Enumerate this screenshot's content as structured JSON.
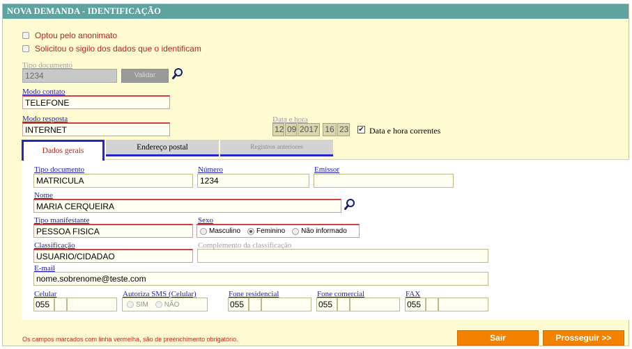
{
  "title": "NOVA DEMANDA - IDENTIFICAÇÃO",
  "options": {
    "anonimato": "Optou pelo anonimato",
    "sigilo": "Solicitou o sigilo dos dados que o identificam"
  },
  "tipo_documento": {
    "label": "Tipo documento",
    "value": "1234",
    "validar_label": "Validar"
  },
  "modo_contato": {
    "label": "Modo contato",
    "value": "TELEFONE"
  },
  "modo_resposta": {
    "label": "Modo resposta",
    "value": "INTERNET"
  },
  "data_hora": {
    "label": "Data e hora",
    "day": "12",
    "month": "09",
    "year": "2017",
    "hour": "16",
    "minute": "23",
    "correntes_label": "Data e hora correntes",
    "correntes_checked": true
  },
  "tabs": [
    {
      "label": "Dados gerais",
      "active": true
    },
    {
      "label": "Endereço postal",
      "active": false
    },
    {
      "label": "Registros anteriores",
      "active": false,
      "disabled": true
    }
  ],
  "form": {
    "tipo_documento": {
      "label": "Tipo documento",
      "value": "MATRICULA"
    },
    "numero": {
      "label": "Número",
      "value": "1234"
    },
    "emissor": {
      "label": "Emissor",
      "value": ""
    },
    "nome": {
      "label": "Nome",
      "value": "MARIA CERQUEIRA"
    },
    "tipo_manifestante": {
      "label": "Tipo manifestante",
      "value": "PESSOA FISICA"
    },
    "sexo": {
      "label": "Sexo",
      "options": [
        "Masculino",
        "Feminino",
        "Não informado"
      ],
      "selected": "Feminino"
    },
    "classificacao": {
      "label": "Classificação",
      "value": "USUARIO/CIDADAO"
    },
    "complemento": {
      "label": "Complemento da classificação",
      "value": ""
    },
    "email": {
      "label": "E-mail",
      "value": "nome.sobrenome@teste.com"
    },
    "celular": {
      "label": "Celular",
      "ddd": "055"
    },
    "autoriza_sms": {
      "label": "Autoriza SMS (Celular)",
      "options": [
        "SIM",
        "NÃO"
      ]
    },
    "fone_residencial": {
      "label": "Fone residencial",
      "ddd": "055"
    },
    "fone_comercial": {
      "label": "Fone comercial",
      "ddd": "055"
    },
    "fax": {
      "label": "FAX",
      "ddd": "055"
    }
  },
  "footer": {
    "note": "Os campos marcados com linha vermelha, são de preenchimento obrigatório.",
    "sair": "Sair",
    "prosseguir": "Prosseguir >>"
  },
  "colors": {
    "title_bar": "#5fa3a0",
    "background": "#fefbd2",
    "required_border": "#d04040",
    "label": "#1c1cb4",
    "button": "#f28200"
  },
  "icons": {
    "search": "magnifier-icon"
  }
}
